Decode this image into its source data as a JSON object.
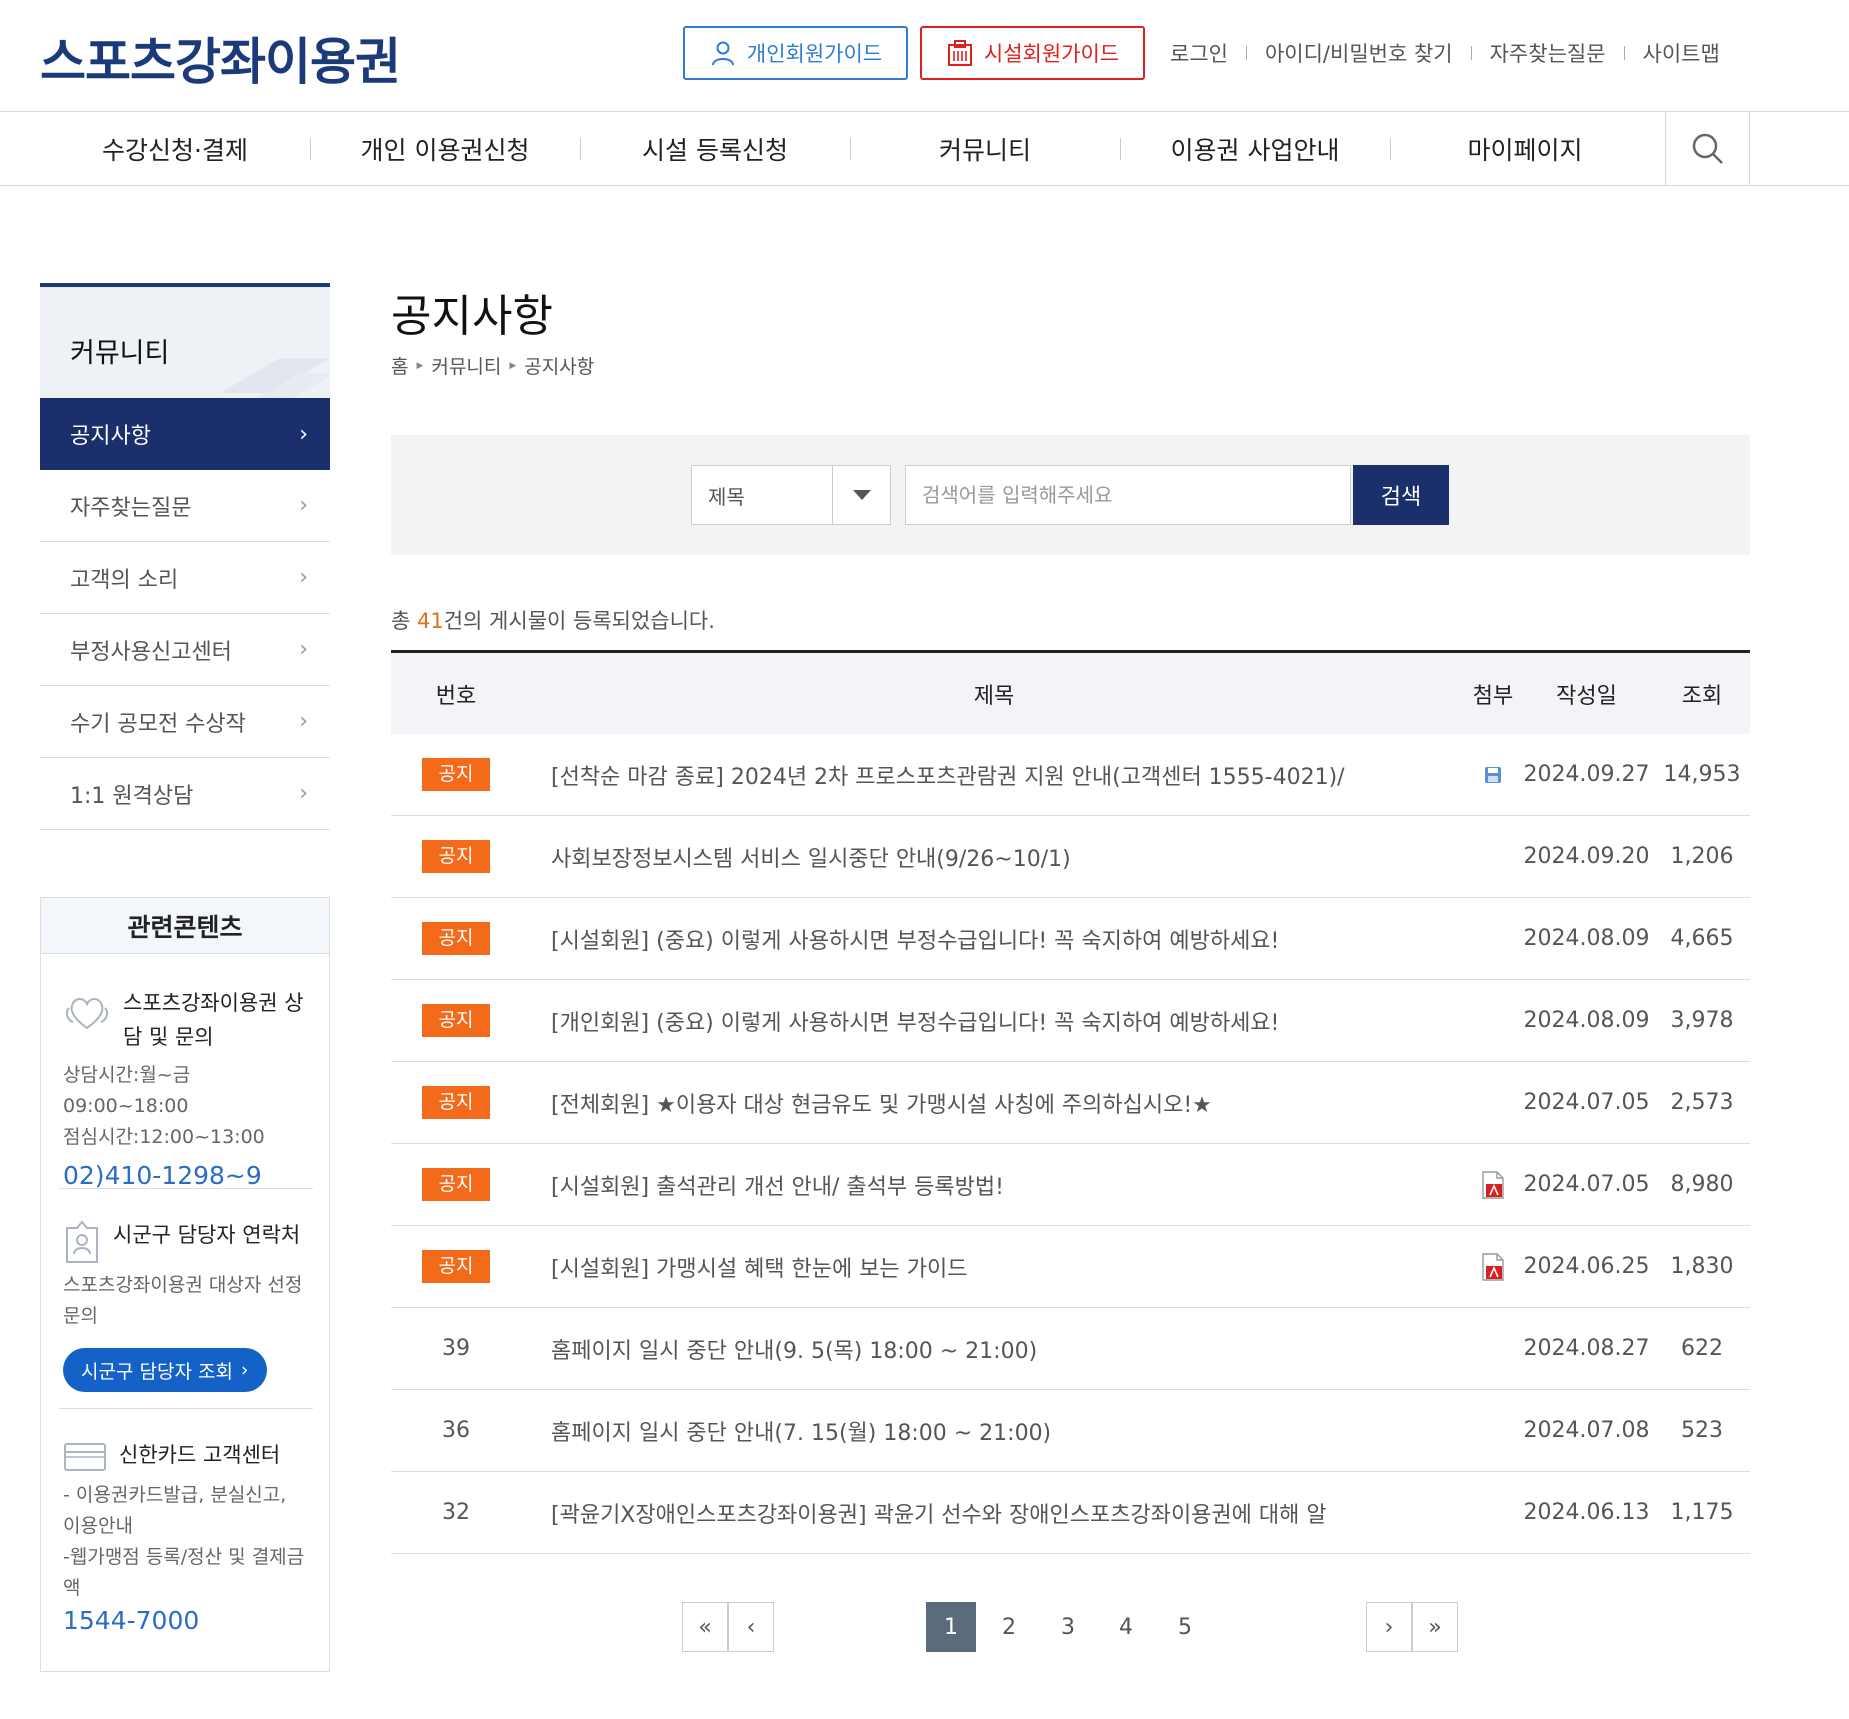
{
  "header": {
    "logo": "스포츠강좌이용권",
    "guide_personal": "개인회원가이드",
    "guide_facility": "시설회원가이드",
    "util_links": [
      "로그인",
      "아이디/비밀번호 찾기",
      "자주찾는질문",
      "사이트맵"
    ]
  },
  "gnb": [
    "수강신청·결제",
    "개인 이용권신청",
    "시설 등록신청",
    "커뮤니티",
    "이용권 사업안내",
    "마이페이지"
  ],
  "lnb": {
    "title": "커뮤니티",
    "items": [
      "공지사항",
      "자주찾는질문",
      "고객의 소리",
      "부정사용신고센터",
      "수기 공모전 수상작",
      "1:1 원격상담"
    ]
  },
  "related": {
    "title": "관련콘텐츠",
    "consult_title": "스포츠강좌이용권 상담 및 문의",
    "consult_hours": "상담시간:월~금 09:00~18:00",
    "lunch_hours": "점심시간:12:00~13:00",
    "consult_phone": "02)410-1298~9",
    "local_title": "시군구 담당자 연락처",
    "local_desc": "스포츠강좌이용권 대상자 선정 문의",
    "local_button": "시군구 담당자 조회",
    "card_title": "신한카드 고객센터",
    "card_desc1": "- 이용권카드발급, 분실신고, 이용안내",
    "card_desc2": "-웹가맹점 등록/정산 및 결제금액",
    "card_phone": "1544-7000"
  },
  "page": {
    "title": "공지사항",
    "breadcrumb": [
      "홈",
      "커뮤니티",
      "공지사항"
    ]
  },
  "search": {
    "field": "제목",
    "placeholder": "검색어를 입력해주세요",
    "button": "검색"
  },
  "total": {
    "prefix": "총 ",
    "count": "41",
    "suffix": "건의 게시물이 등록되었습니다."
  },
  "table": {
    "headers": [
      "번호",
      "제목",
      "첨부",
      "작성일",
      "조회"
    ],
    "rows": [
      {
        "no": "공지",
        "notice": true,
        "title": "[선착순 마감 종료] 2024년 2차 프로스포츠관람권 지원 안내(고객센터 1555-4021)/",
        "attach": "file-icon",
        "date": "2024.09.27",
        "views": "14,953"
      },
      {
        "no": "공지",
        "notice": true,
        "title": "사회보장정보시스템 서비스 일시중단 안내(9/26~10/1)",
        "attach": "",
        "date": "2024.09.20",
        "views": "1,206"
      },
      {
        "no": "공지",
        "notice": true,
        "title": "[시설회원] (중요) 이렇게 사용하시면 부정수급입니다! 꼭 숙지하여 예방하세요!",
        "attach": "",
        "date": "2024.08.09",
        "views": "4,665"
      },
      {
        "no": "공지",
        "notice": true,
        "title": "[개인회원] (중요) 이렇게 사용하시면 부정수급입니다! 꼭 숙지하여 예방하세요!",
        "attach": "",
        "date": "2024.08.09",
        "views": "3,978"
      },
      {
        "no": "공지",
        "notice": true,
        "title": "[전체회원] ★이용자 대상 현금유도 및 가맹시설 사칭에 주의하십시오!★",
        "attach": "",
        "date": "2024.07.05",
        "views": "2,573"
      },
      {
        "no": "공지",
        "notice": true,
        "title": "[시설회원] 출석관리 개선 안내/ 출석부 등록방법!",
        "attach": "pdf-icon",
        "date": "2024.07.05",
        "views": "8,980"
      },
      {
        "no": "공지",
        "notice": true,
        "title": "[시설회원] 가맹시설 혜택 한눈에 보는 가이드",
        "attach": "pdf-icon",
        "date": "2024.06.25",
        "views": "1,830"
      },
      {
        "no": "39",
        "notice": false,
        "title": "홈페이지 일시 중단 안내(9. 5(목) 18:00 ~ 21:00)",
        "attach": "",
        "date": "2024.08.27",
        "views": "622"
      },
      {
        "no": "36",
        "notice": false,
        "title": "홈페이지 일시 중단 안내(7. 15(월) 18:00 ~ 21:00)",
        "attach": "",
        "date": "2024.07.08",
        "views": "523"
      },
      {
        "no": "32",
        "notice": false,
        "title": "[곽윤기X장애인스포츠강좌이용권] 곽윤기 선수와 장애인스포츠강좌이용권에 대해 알",
        "attach": "",
        "date": "2024.06.13",
        "views": "1,175"
      }
    ]
  },
  "pagination": {
    "pages": [
      "1",
      "2",
      "3",
      "4",
      "5"
    ],
    "current": "1"
  },
  "colors": {
    "navy": "#1a2f6b",
    "notice_badge": "#f26a1a",
    "personal_guide": "#2d7dd2",
    "facility_guide": "#e02020"
  }
}
